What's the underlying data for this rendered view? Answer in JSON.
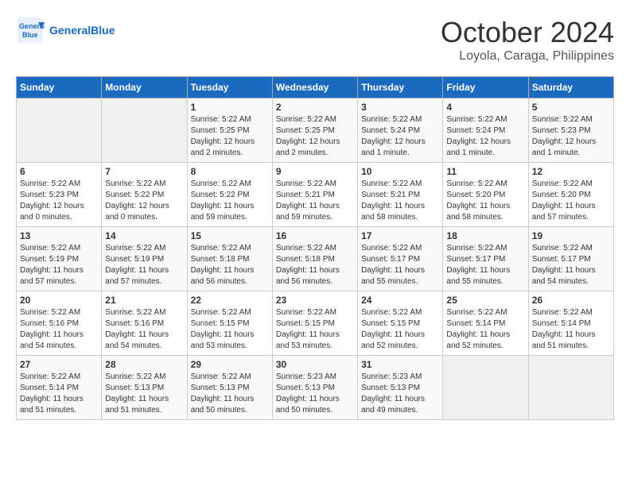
{
  "header": {
    "logo_line1": "General",
    "logo_line2": "Blue",
    "month": "October 2024",
    "location": "Loyola, Caraga, Philippines"
  },
  "weekdays": [
    "Sunday",
    "Monday",
    "Tuesday",
    "Wednesday",
    "Thursday",
    "Friday",
    "Saturday"
  ],
  "weeks": [
    [
      {
        "day": "",
        "sunrise": "",
        "sunset": "",
        "daylight": ""
      },
      {
        "day": "",
        "sunrise": "",
        "sunset": "",
        "daylight": ""
      },
      {
        "day": "1",
        "sunrise": "Sunrise: 5:22 AM",
        "sunset": "Sunset: 5:25 PM",
        "daylight": "Daylight: 12 hours and 2 minutes."
      },
      {
        "day": "2",
        "sunrise": "Sunrise: 5:22 AM",
        "sunset": "Sunset: 5:25 PM",
        "daylight": "Daylight: 12 hours and 2 minutes."
      },
      {
        "day": "3",
        "sunrise": "Sunrise: 5:22 AM",
        "sunset": "Sunset: 5:24 PM",
        "daylight": "Daylight: 12 hours and 1 minute."
      },
      {
        "day": "4",
        "sunrise": "Sunrise: 5:22 AM",
        "sunset": "Sunset: 5:24 PM",
        "daylight": "Daylight: 12 hours and 1 minute."
      },
      {
        "day": "5",
        "sunrise": "Sunrise: 5:22 AM",
        "sunset": "Sunset: 5:23 PM",
        "daylight": "Daylight: 12 hours and 1 minute."
      }
    ],
    [
      {
        "day": "6",
        "sunrise": "Sunrise: 5:22 AM",
        "sunset": "Sunset: 5:23 PM",
        "daylight": "Daylight: 12 hours and 0 minutes."
      },
      {
        "day": "7",
        "sunrise": "Sunrise: 5:22 AM",
        "sunset": "Sunset: 5:22 PM",
        "daylight": "Daylight: 12 hours and 0 minutes."
      },
      {
        "day": "8",
        "sunrise": "Sunrise: 5:22 AM",
        "sunset": "Sunset: 5:22 PM",
        "daylight": "Daylight: 11 hours and 59 minutes."
      },
      {
        "day": "9",
        "sunrise": "Sunrise: 5:22 AM",
        "sunset": "Sunset: 5:21 PM",
        "daylight": "Daylight: 11 hours and 59 minutes."
      },
      {
        "day": "10",
        "sunrise": "Sunrise: 5:22 AM",
        "sunset": "Sunset: 5:21 PM",
        "daylight": "Daylight: 11 hours and 58 minutes."
      },
      {
        "day": "11",
        "sunrise": "Sunrise: 5:22 AM",
        "sunset": "Sunset: 5:20 PM",
        "daylight": "Daylight: 11 hours and 58 minutes."
      },
      {
        "day": "12",
        "sunrise": "Sunrise: 5:22 AM",
        "sunset": "Sunset: 5:20 PM",
        "daylight": "Daylight: 11 hours and 57 minutes."
      }
    ],
    [
      {
        "day": "13",
        "sunrise": "Sunrise: 5:22 AM",
        "sunset": "Sunset: 5:19 PM",
        "daylight": "Daylight: 11 hours and 57 minutes."
      },
      {
        "day": "14",
        "sunrise": "Sunrise: 5:22 AM",
        "sunset": "Sunset: 5:19 PM",
        "daylight": "Daylight: 11 hours and 57 minutes."
      },
      {
        "day": "15",
        "sunrise": "Sunrise: 5:22 AM",
        "sunset": "Sunset: 5:18 PM",
        "daylight": "Daylight: 11 hours and 56 minutes."
      },
      {
        "day": "16",
        "sunrise": "Sunrise: 5:22 AM",
        "sunset": "Sunset: 5:18 PM",
        "daylight": "Daylight: 11 hours and 56 minutes."
      },
      {
        "day": "17",
        "sunrise": "Sunrise: 5:22 AM",
        "sunset": "Sunset: 5:17 PM",
        "daylight": "Daylight: 11 hours and 55 minutes."
      },
      {
        "day": "18",
        "sunrise": "Sunrise: 5:22 AM",
        "sunset": "Sunset: 5:17 PM",
        "daylight": "Daylight: 11 hours and 55 minutes."
      },
      {
        "day": "19",
        "sunrise": "Sunrise: 5:22 AM",
        "sunset": "Sunset: 5:17 PM",
        "daylight": "Daylight: 11 hours and 54 minutes."
      }
    ],
    [
      {
        "day": "20",
        "sunrise": "Sunrise: 5:22 AM",
        "sunset": "Sunset: 5:16 PM",
        "daylight": "Daylight: 11 hours and 54 minutes."
      },
      {
        "day": "21",
        "sunrise": "Sunrise: 5:22 AM",
        "sunset": "Sunset: 5:16 PM",
        "daylight": "Daylight: 11 hours and 54 minutes."
      },
      {
        "day": "22",
        "sunrise": "Sunrise: 5:22 AM",
        "sunset": "Sunset: 5:15 PM",
        "daylight": "Daylight: 11 hours and 53 minutes."
      },
      {
        "day": "23",
        "sunrise": "Sunrise: 5:22 AM",
        "sunset": "Sunset: 5:15 PM",
        "daylight": "Daylight: 11 hours and 53 minutes."
      },
      {
        "day": "24",
        "sunrise": "Sunrise: 5:22 AM",
        "sunset": "Sunset: 5:15 PM",
        "daylight": "Daylight: 11 hours and 52 minutes."
      },
      {
        "day": "25",
        "sunrise": "Sunrise: 5:22 AM",
        "sunset": "Sunset: 5:14 PM",
        "daylight": "Daylight: 11 hours and 52 minutes."
      },
      {
        "day": "26",
        "sunrise": "Sunrise: 5:22 AM",
        "sunset": "Sunset: 5:14 PM",
        "daylight": "Daylight: 11 hours and 51 minutes."
      }
    ],
    [
      {
        "day": "27",
        "sunrise": "Sunrise: 5:22 AM",
        "sunset": "Sunset: 5:14 PM",
        "daylight": "Daylight: 11 hours and 51 minutes."
      },
      {
        "day": "28",
        "sunrise": "Sunrise: 5:22 AM",
        "sunset": "Sunset: 5:13 PM",
        "daylight": "Daylight: 11 hours and 51 minutes."
      },
      {
        "day": "29",
        "sunrise": "Sunrise: 5:22 AM",
        "sunset": "Sunset: 5:13 PM",
        "daylight": "Daylight: 11 hours and 50 minutes."
      },
      {
        "day": "30",
        "sunrise": "Sunrise: 5:23 AM",
        "sunset": "Sunset: 5:13 PM",
        "daylight": "Daylight: 11 hours and 50 minutes."
      },
      {
        "day": "31",
        "sunrise": "Sunrise: 5:23 AM",
        "sunset": "Sunset: 5:13 PM",
        "daylight": "Daylight: 11 hours and 49 minutes."
      },
      {
        "day": "",
        "sunrise": "",
        "sunset": "",
        "daylight": ""
      },
      {
        "day": "",
        "sunrise": "",
        "sunset": "",
        "daylight": ""
      }
    ]
  ]
}
